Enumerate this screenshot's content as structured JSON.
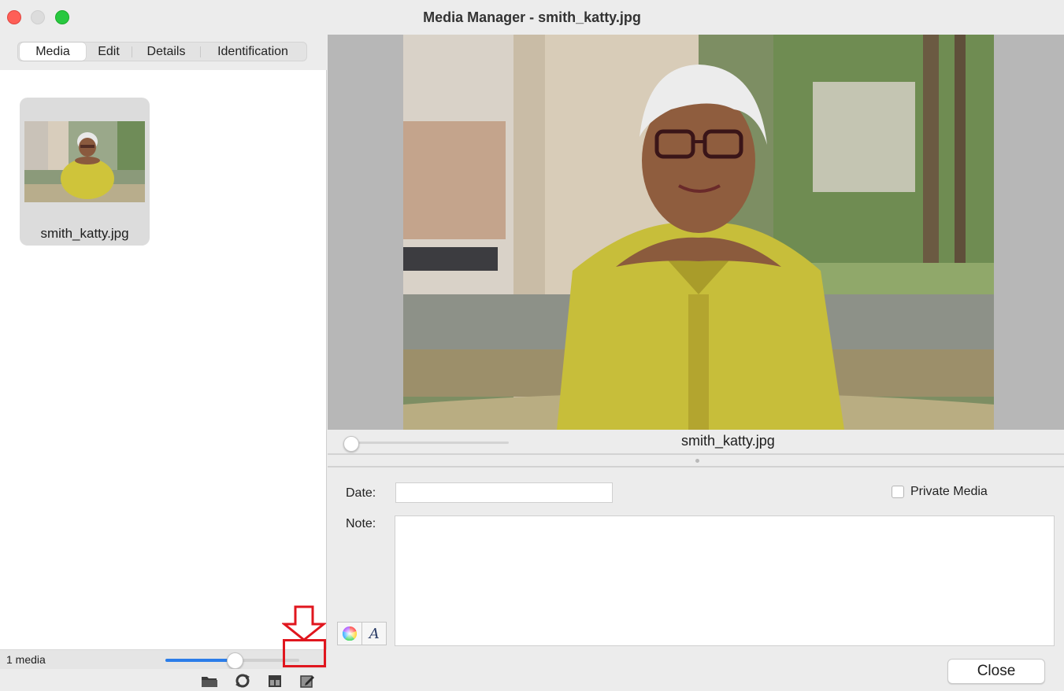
{
  "window": {
    "title": "Media Manager - smith_katty.jpg"
  },
  "tabs": [
    {
      "label": "Media"
    },
    {
      "label": "Edit"
    },
    {
      "label": "Details"
    },
    {
      "label": "Identification"
    }
  ],
  "media_list": {
    "items": [
      {
        "filename": "smith_katty.jpg"
      }
    ],
    "count_label": "1 media",
    "thumbnail_size_fraction": 0.52
  },
  "toolbar": {
    "icons": [
      "folder-open-icon",
      "refresh-icon",
      "export-icon",
      "edit-external-icon"
    ]
  },
  "preview": {
    "filename": "smith_katty.jpg",
    "zoom_fraction": 0.0
  },
  "form": {
    "date_label": "Date:",
    "date_value": "",
    "private_label": "Private Media",
    "private_checked": false,
    "note_label": "Note:",
    "note_value": ""
  },
  "buttons": {
    "close_label": "Close"
  },
  "colors": {
    "accent": "#2b7de9",
    "annotation": "#e0161e"
  }
}
